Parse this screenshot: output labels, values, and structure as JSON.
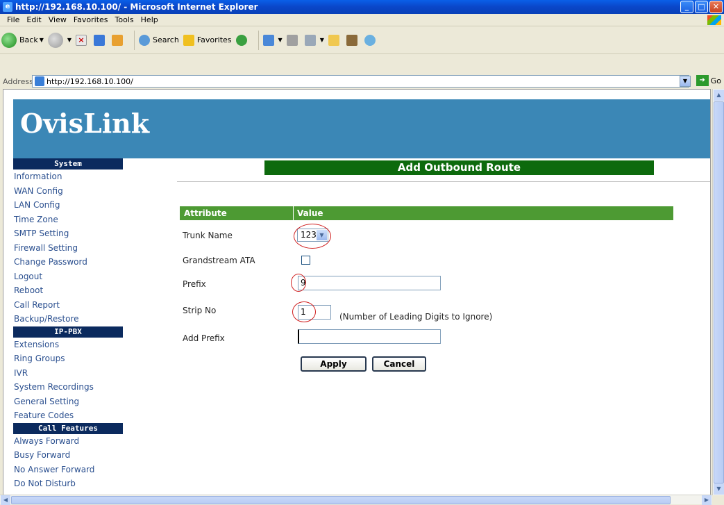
{
  "window": {
    "title": "http://192.168.10.100/ - Microsoft Internet Explorer"
  },
  "menu": [
    "File",
    "Edit",
    "View",
    "Favorites",
    "Tools",
    "Help"
  ],
  "toolbar": {
    "back": "Back",
    "search": "Search",
    "favorites": "Favorites"
  },
  "address": {
    "label": "Address",
    "url": "http://192.168.10.100/",
    "go": "Go"
  },
  "brand": "OvisLink",
  "sidebar": {
    "system_header": "System",
    "system_items": [
      "Information",
      "WAN Config",
      "LAN Config",
      "Time Zone",
      "SMTP Setting",
      "Firewall Setting",
      "Change Password",
      "Logout",
      "Reboot",
      "Call Report",
      "Backup/Restore"
    ],
    "ippbx_header": "IP-PBX",
    "ippbx_items": [
      "Extensions",
      "Ring Groups",
      "IVR",
      "System Recordings",
      "General Setting",
      "Feature Codes"
    ],
    "callfeatures_header": "Call Features",
    "callfeatures_items": [
      "Always Forward",
      "Busy Forward",
      "No Answer Forward",
      "Do Not Disturb"
    ]
  },
  "form": {
    "title": "Add Outbound Route",
    "col_attribute": "Attribute",
    "col_value": "Value",
    "trunk_label": "Trunk Name",
    "trunk_value": "123",
    "ata_label": "Grandstream ATA",
    "prefix_label": "Prefix",
    "prefix_value": "9",
    "strip_label": "Strip No",
    "strip_value": "1",
    "strip_hint": "(Number of Leading Digits to Ignore)",
    "addprefix_label": "Add Prefix",
    "addprefix_value": "",
    "apply": "Apply",
    "cancel": "Cancel"
  }
}
